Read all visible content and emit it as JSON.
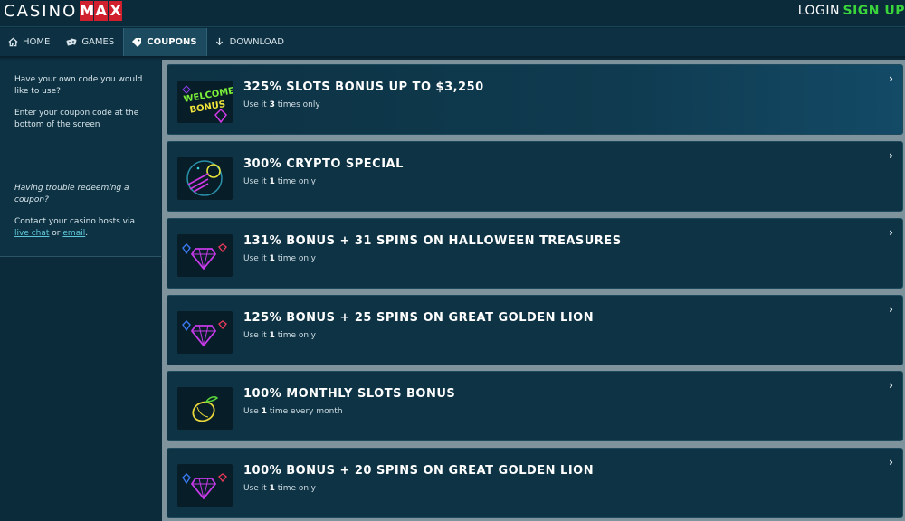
{
  "brand": {
    "part1": "CASINO",
    "part2": [
      "M",
      "A",
      "X"
    ]
  },
  "header": {
    "login": "LOGIN",
    "signup": "SIGN UP"
  },
  "nav": [
    {
      "label": "HOME",
      "icon": "home-icon",
      "active": false
    },
    {
      "label": "GAMES",
      "icon": "games-icon",
      "active": false
    },
    {
      "label": "COUPONS",
      "icon": "coupon-icon",
      "active": true
    },
    {
      "label": "DOWNLOAD",
      "icon": "download-icon",
      "active": false
    }
  ],
  "sidebar": {
    "own_code": "Have your own code you would like to use?",
    "enter_code": "Enter your coupon code at the bottom of the screen",
    "trouble": "Having trouble redeeming a coupon?",
    "contact_prefix": "Contact your casino hosts via",
    "live_chat": "live chat",
    "or": "or",
    "email": "email",
    "period": "."
  },
  "coupons": [
    {
      "title": "325% SLOTS BONUS UP TO $3,250",
      "use_prefix": "Use it",
      "count": "3",
      "use_suffix": "times only",
      "thumb": "welcome-bonus-icon"
    },
    {
      "title": "300% CRYPTO SPECIAL",
      "use_prefix": "Use it",
      "count": "1",
      "use_suffix": "time only",
      "thumb": "crypto-coin-icon"
    },
    {
      "title": "131% BONUS + 31 SPINS ON HALLOWEEN TREASURES",
      "use_prefix": "Use it",
      "count": "1",
      "use_suffix": "time only",
      "thumb": "gems-icon"
    },
    {
      "title": "125% BONUS + 25 SPINS ON GREAT GOLDEN LION",
      "use_prefix": "Use it",
      "count": "1",
      "use_suffix": "time only",
      "thumb": "gems-icon"
    },
    {
      "title": "100% MONTHLY SLOTS BONUS",
      "use_prefix": "Use",
      "count": "1",
      "use_suffix": "time every month",
      "thumb": "lemon-icon"
    },
    {
      "title": "100% BONUS + 20 SPINS ON GREAT GOLDEN LION",
      "use_prefix": "Use it",
      "count": "1",
      "use_suffix": "time only",
      "thumb": "gems-icon"
    }
  ],
  "chevron": "›",
  "colors": {
    "brand_red": "#d0202e",
    "signup_green": "#39d53a",
    "link": "#5ec8d8"
  }
}
